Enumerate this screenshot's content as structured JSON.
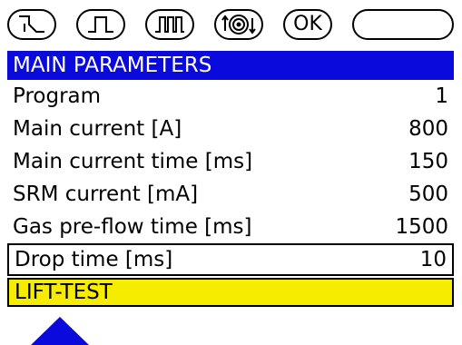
{
  "softkeys": [
    {
      "icon": "pulse-fall-icon"
    },
    {
      "icon": "single-pulse-icon"
    },
    {
      "icon": "multi-pulse-icon"
    },
    {
      "icon": "gas-coil-icon"
    },
    {
      "label": "OK"
    },
    {
      "label": ""
    }
  ],
  "section": {
    "title": "MAIN PARAMETERS"
  },
  "parameters": [
    {
      "label": "Program",
      "value": "1"
    },
    {
      "label": "Main current [A]",
      "value": "800"
    },
    {
      "label": "Main current time [ms]",
      "value": "150"
    },
    {
      "label": "SRM current [mA]",
      "value": "500"
    },
    {
      "label": "Gas pre-flow time [ms]",
      "value": "1500"
    },
    {
      "label": "Drop time [ms]",
      "value": "10"
    }
  ],
  "status": {
    "text": "LIFT-TEST"
  },
  "colors": {
    "header_bg": "#0a0adc",
    "status_bg": "#f5ec00",
    "arrow": "#0a0adc"
  }
}
